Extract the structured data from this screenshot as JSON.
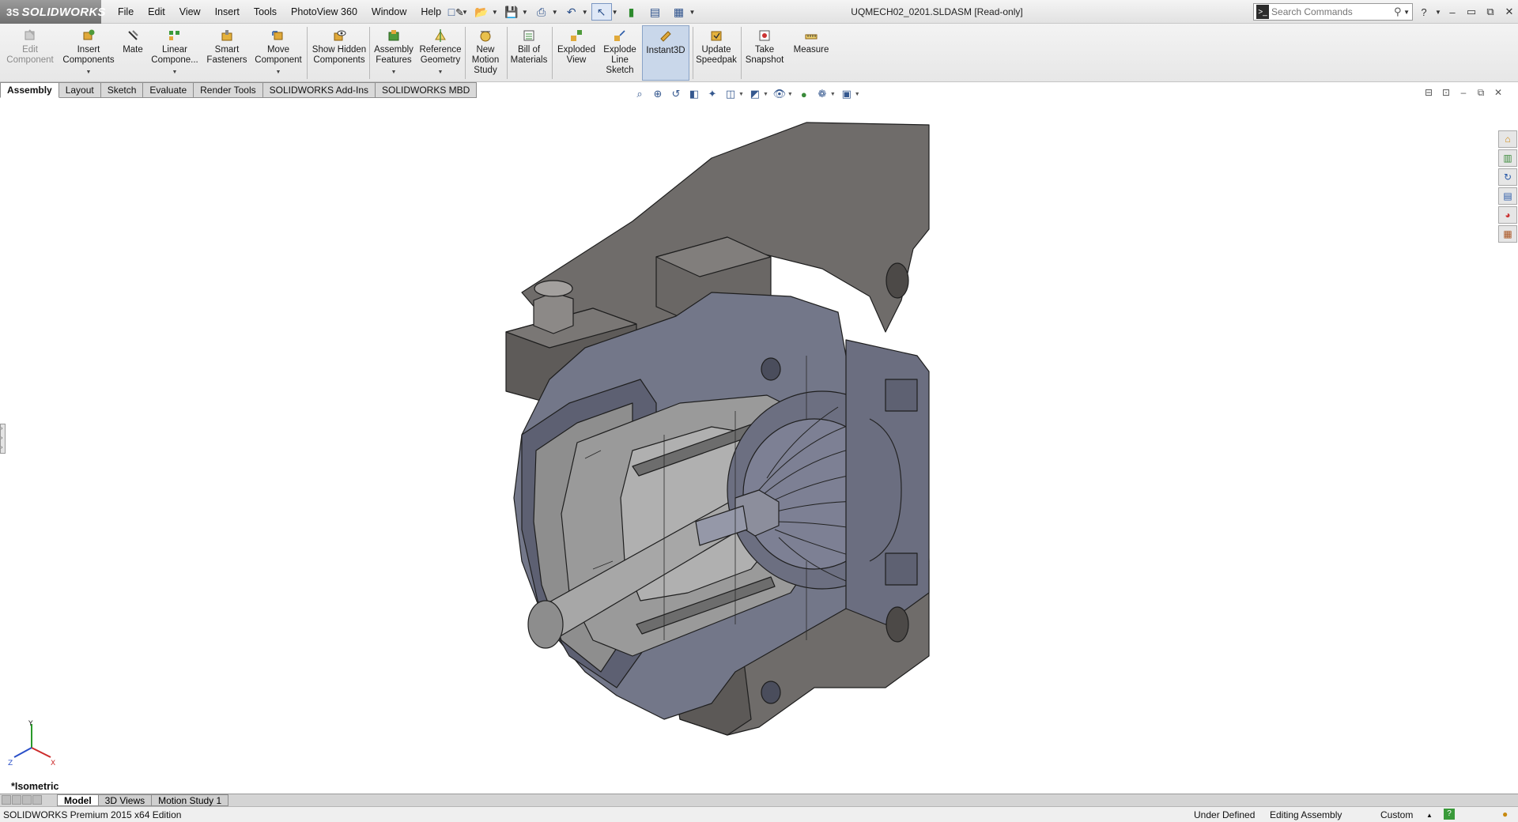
{
  "app": {
    "logo": "SOLIDWORKS",
    "document_title": "UQMECH02_0201.SLDASM [Read-only]"
  },
  "menu": [
    "File",
    "Edit",
    "View",
    "Insert",
    "Tools",
    "PhotoView 360",
    "Window",
    "Help"
  ],
  "search": {
    "placeholder": "Search Commands"
  },
  "ribbon": [
    {
      "label": "Edit Component",
      "icon": "edit-component-icon",
      "disabled": true
    },
    {
      "label": "Insert Components",
      "icon": "insert-components-icon",
      "dropdown": true
    },
    {
      "label": "Mate",
      "icon": "mate-icon"
    },
    {
      "label": "Linear Compone...",
      "icon": "linear-pattern-icon",
      "dropdown": true
    },
    {
      "label": "Smart Fasteners",
      "icon": "smart-fasteners-icon"
    },
    {
      "label": "Move Component",
      "icon": "move-component-icon",
      "dropdown": true
    },
    {
      "label": "Show Hidden Components",
      "icon": "show-hidden-icon"
    },
    {
      "label": "Assembly Features",
      "icon": "assembly-features-icon",
      "dropdown": true
    },
    {
      "label": "Reference Geometry",
      "icon": "reference-geometry-icon",
      "dropdown": true
    },
    {
      "label": "New Motion Study",
      "icon": "motion-study-icon"
    },
    {
      "label": "Bill of Materials",
      "icon": "bill-of-materials-icon"
    },
    {
      "label": "Exploded View",
      "icon": "exploded-view-icon"
    },
    {
      "label": "Explode Line Sketch",
      "icon": "explode-line-icon"
    },
    {
      "label": "Instant3D",
      "icon": "instant3d-icon",
      "active": true
    },
    {
      "label": "Update Speedpak",
      "icon": "speedpak-icon"
    },
    {
      "label": "Take Snapshot",
      "icon": "snapshot-icon"
    },
    {
      "label": "Measure",
      "icon": "measure-icon"
    }
  ],
  "tabs": [
    "Assembly",
    "Layout",
    "Sketch",
    "Evaluate",
    "Render Tools",
    "SOLIDWORKS Add-Ins",
    "SOLIDWORKS MBD"
  ],
  "active_tab": "Assembly",
  "viewport": {
    "view_orientation": "*Isometric"
  },
  "bottom_tabs": [
    "Model",
    "3D Views",
    "Motion Study 1"
  ],
  "status": {
    "edition": "SOLIDWORKS Premium 2015 x64 Edition",
    "definition": "Under Defined",
    "mode": "Editing Assembly",
    "units": "Custom"
  },
  "colors": {
    "housing": "#6f6c6a",
    "body": "#737789",
    "section_cut": "#9a9a9a",
    "accent_active": "#c9d7ea"
  }
}
